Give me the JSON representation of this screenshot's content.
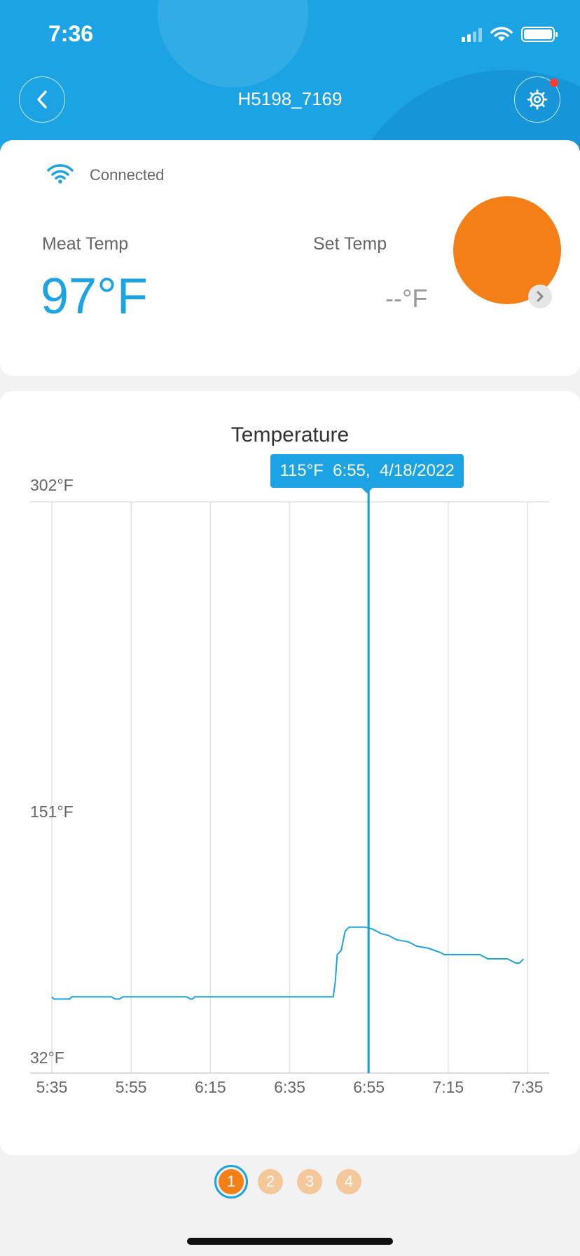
{
  "status_bar": {
    "time": "7:36"
  },
  "header": {
    "title": "H5198_7169"
  },
  "probe": {
    "number": "1"
  },
  "connection": {
    "status": "Connected"
  },
  "readings": {
    "meat_label": "Meat Temp",
    "meat_value": "97°F",
    "set_label": "Set Temp",
    "set_value": "--°F"
  },
  "chart_title": "Temperature",
  "tooltip": {
    "text": "115°F  6:55,  4/18/2022"
  },
  "chart_data": {
    "type": "line",
    "title": "Temperature",
    "y_ticks": [
      "302°F",
      "151°F",
      "32°F"
    ],
    "x_ticks": [
      "5:35",
      "5:55",
      "6:15",
      "6:35",
      "6:55",
      "7:15",
      "7:35"
    ],
    "xlim": [
      0,
      120
    ],
    "ylim": [
      32,
      302
    ],
    "series": [
      {
        "color": "#1ba3e3",
        "points": [
          [
            0,
            68
          ],
          [
            0.5,
            67
          ],
          [
            4.5,
            67
          ],
          [
            5,
            68
          ],
          [
            15,
            68
          ],
          [
            16,
            67
          ],
          [
            17,
            67
          ],
          [
            18,
            68
          ],
          [
            34,
            68
          ],
          [
            35,
            67
          ],
          [
            35.5,
            67
          ],
          [
            36,
            68
          ],
          [
            71,
            68
          ],
          [
            71.5,
            75
          ],
          [
            72,
            88
          ],
          [
            73,
            90
          ],
          [
            74,
            99
          ],
          [
            75,
            101
          ],
          [
            79,
            101
          ],
          [
            81,
            100
          ],
          [
            83,
            98
          ],
          [
            85,
            97
          ],
          [
            87,
            95
          ],
          [
            90,
            94
          ],
          [
            92,
            92
          ],
          [
            95,
            91
          ],
          [
            98,
            89
          ],
          [
            99,
            88
          ],
          [
            108,
            88
          ],
          [
            110,
            86
          ],
          [
            115,
            86
          ],
          [
            117,
            84
          ],
          [
            118,
            84
          ],
          [
            119,
            86
          ]
        ]
      }
    ],
    "selected": {
      "x_label": "6:55",
      "value": "115°F",
      "date": "4/18/2022"
    },
    "grid": true
  },
  "pager": {
    "pages": [
      "1",
      "2",
      "3",
      "4"
    ],
    "active": 0
  }
}
